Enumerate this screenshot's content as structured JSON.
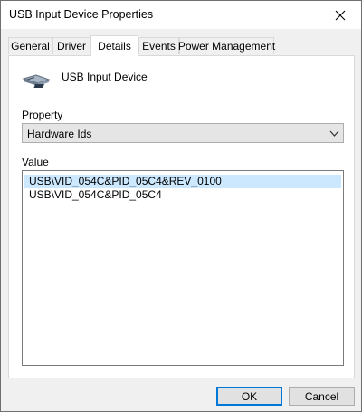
{
  "window": {
    "title": "USB Input Device Properties",
    "close_icon": "close-icon"
  },
  "tabs": [
    {
      "label": "General",
      "active": false
    },
    {
      "label": "Driver",
      "active": false
    },
    {
      "label": "Details",
      "active": true
    },
    {
      "label": "Events",
      "active": false
    },
    {
      "label": "Power Management",
      "active": false
    }
  ],
  "device": {
    "name": "USB Input Device",
    "icon": "usb-device-icon"
  },
  "property": {
    "label": "Property",
    "selected": "Hardware Ids"
  },
  "value": {
    "label": "Value",
    "items": [
      "USB\\VID_054C&PID_05C4&REV_0100",
      "USB\\VID_054C&PID_05C4"
    ],
    "selected_index": 0
  },
  "buttons": {
    "ok": "OK",
    "cancel": "Cancel"
  },
  "colors": {
    "selection": "#cce8ff",
    "default_button_border": "#0078d7"
  }
}
